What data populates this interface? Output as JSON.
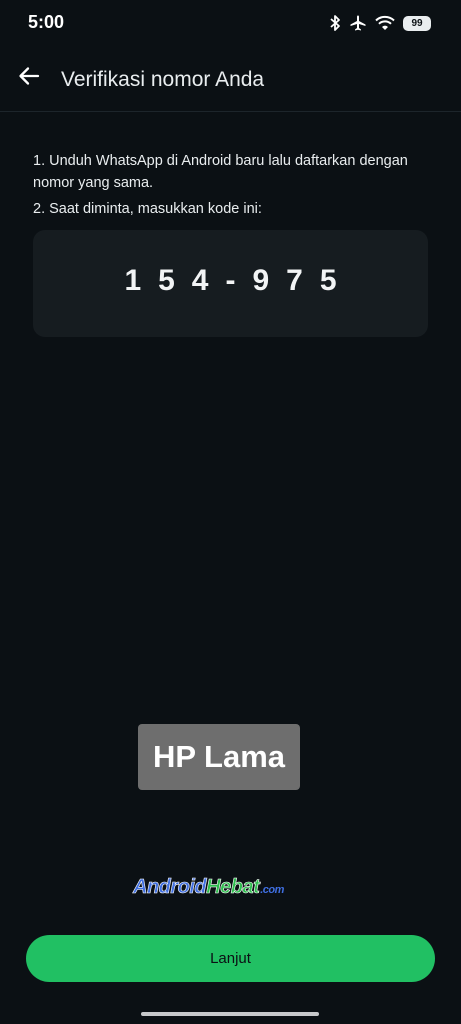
{
  "status_bar": {
    "time": "5:00",
    "icons": [
      "bluetooth-icon",
      "airplane-icon",
      "wifi-icon",
      "battery-icon"
    ],
    "battery_level": "99"
  },
  "app_bar": {
    "back_icon": "arrow-left-icon",
    "title": "Verifikasi nomor Anda"
  },
  "instructions": {
    "step1": "1. Unduh WhatsApp di Android baru lalu daftarkan dengan nomor yang sama.",
    "step2": "2. Saat diminta, masukkan kode ini:"
  },
  "code": "154-975",
  "overlay_label": "HP Lama",
  "watermark": {
    "part1": "Android",
    "part2": "Hebat",
    "part3": ".com"
  },
  "button": {
    "label": "Lanjut"
  },
  "colors": {
    "background": "#0b1014",
    "card": "#161c20",
    "accent": "#21c063",
    "text": "#e9edef"
  }
}
